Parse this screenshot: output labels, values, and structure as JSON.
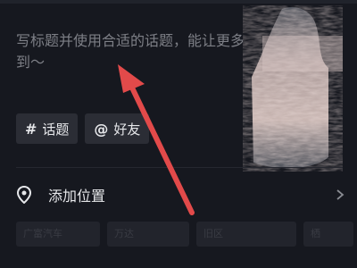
{
  "post": {
    "caption_placeholder": "写标题并使用合适的话题，能让更多人看到～"
  },
  "chips": {
    "topic": {
      "symbol": "#",
      "label": "话题"
    },
    "friend": {
      "symbol": "@",
      "label": "好友"
    }
  },
  "location": {
    "label": "添加位置",
    "icon": "location-pin-icon",
    "chevron": "chevron-right-icon"
  },
  "suggestions": [
    "广富汽车",
    "万达",
    "旧区",
    "栖"
  ],
  "annotation": {
    "type": "red-arrow",
    "color": "#e24a4a"
  },
  "colors": {
    "background": "#16181f",
    "chip_bg": "#2b2d35",
    "placeholder": "#7d7f86",
    "text": "#e6e7ea"
  }
}
